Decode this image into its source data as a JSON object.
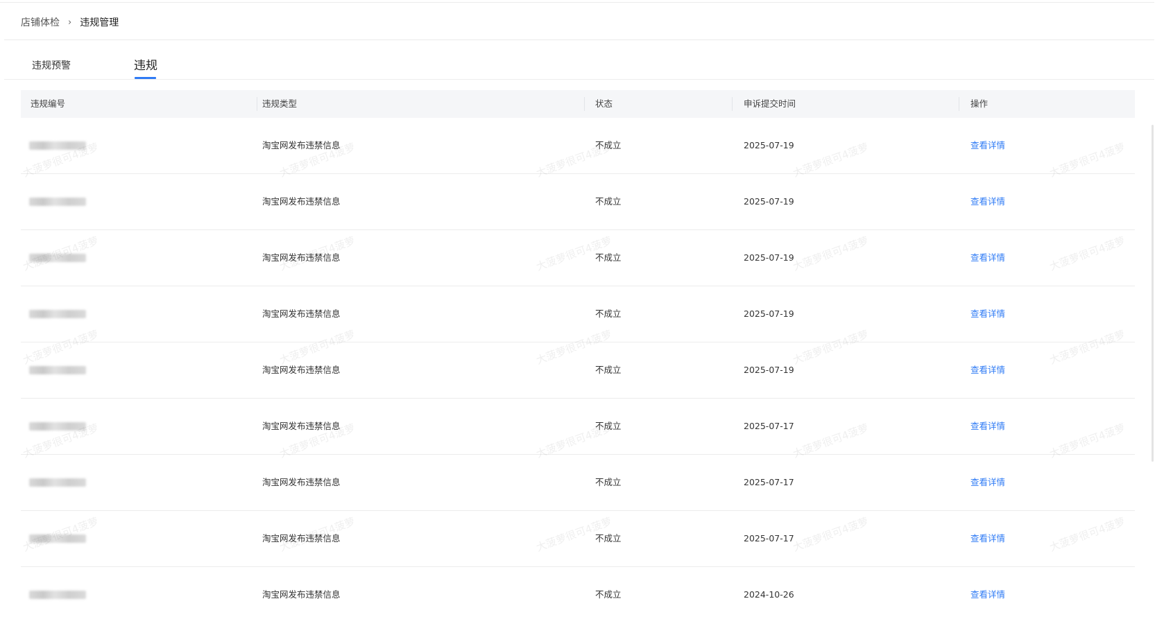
{
  "breadcrumb": {
    "parent": "店铺体检",
    "separator": "›",
    "current": "违规管理"
  },
  "tabs": [
    {
      "label": "违规预警",
      "active": false
    },
    {
      "label": "违规",
      "active": true
    }
  ],
  "table": {
    "headers": {
      "id": "违规编号",
      "type": "违规类型",
      "status": "状态",
      "appeal_time": "申诉提交时间",
      "action": "操作"
    },
    "rows": [
      {
        "type": "淘宝网发布违禁信息",
        "status": "不成立",
        "appeal_time": "2025-07-19",
        "action": "查看详情"
      },
      {
        "type": "淘宝网发布违禁信息",
        "status": "不成立",
        "appeal_time": "2025-07-19",
        "action": "查看详情"
      },
      {
        "type": "淘宝网发布违禁信息",
        "status": "不成立",
        "appeal_time": "2025-07-19",
        "action": "查看详情"
      },
      {
        "type": "淘宝网发布违禁信息",
        "status": "不成立",
        "appeal_time": "2025-07-19",
        "action": "查看详情"
      },
      {
        "type": "淘宝网发布违禁信息",
        "status": "不成立",
        "appeal_time": "2025-07-19",
        "action": "查看详情"
      },
      {
        "type": "淘宝网发布违禁信息",
        "status": "不成立",
        "appeal_time": "2025-07-17",
        "action": "查看详情"
      },
      {
        "type": "淘宝网发布违禁信息",
        "status": "不成立",
        "appeal_time": "2025-07-17",
        "action": "查看详情"
      },
      {
        "type": "淘宝网发布违禁信息",
        "status": "不成立",
        "appeal_time": "2025-07-17",
        "action": "查看详情"
      },
      {
        "type": "淘宝网发布违禁信息",
        "status": "不成立",
        "appeal_time": "2024-10-26",
        "action": "查看详情"
      }
    ]
  },
  "watermark_text": "大菠萝很可4菠萝",
  "colors": {
    "accent": "#2f7bf5",
    "header_bg": "#f5f6f8"
  }
}
